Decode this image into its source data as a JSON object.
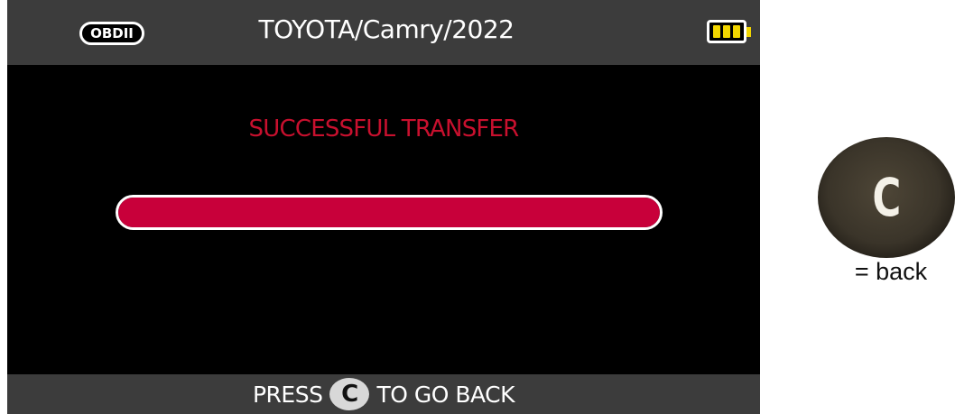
{
  "header": {
    "connection_badge": "OBDII",
    "vehicle_title": "TOYOTA/Camry/2022",
    "battery_icon": "battery-full-icon",
    "battery_color": "#f2d600"
  },
  "main": {
    "status_message": "SUCCESSFUL TRANSFER",
    "status_color": "#c8102e",
    "progress_percent": 100
  },
  "footer": {
    "instruction_prefix": "PRESS",
    "key_label": "C",
    "instruction_suffix": "TO GO BACK"
  },
  "legend": {
    "button_label": "C",
    "button_meaning": "= back"
  }
}
